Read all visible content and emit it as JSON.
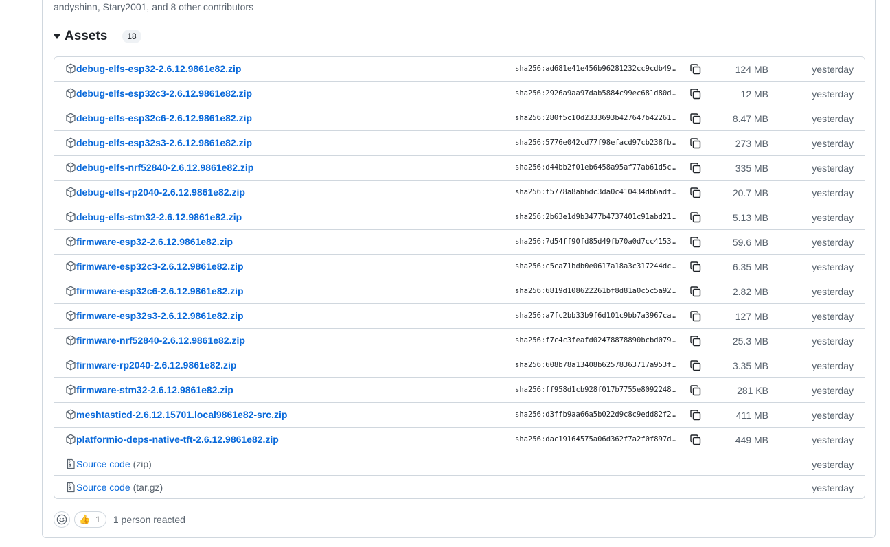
{
  "release": {
    "contributors_text": "andyshinn, Stary2001, and 8 other contributors"
  },
  "assets": {
    "title": "Assets",
    "count": "18",
    "items": [
      {
        "name": "debug-elfs-esp32-2.6.12.9861e82.zip",
        "sha": "sha256:ad681e41e456b96281232cc9cdb49…",
        "size": "124 MB",
        "date": "yesterday"
      },
      {
        "name": "debug-elfs-esp32c3-2.6.12.9861e82.zip",
        "sha": "sha256:2926a9aa97dab5884c99ec681d80d…",
        "size": "12 MB",
        "date": "yesterday"
      },
      {
        "name": "debug-elfs-esp32c6-2.6.12.9861e82.zip",
        "sha": "sha256:280f5c10d2333693b427647b42261…",
        "size": "8.47 MB",
        "date": "yesterday"
      },
      {
        "name": "debug-elfs-esp32s3-2.6.12.9861e82.zip",
        "sha": "sha256:5776e042cd77f98efacd97cb238fb…",
        "size": "273 MB",
        "date": "yesterday"
      },
      {
        "name": "debug-elfs-nrf52840-2.6.12.9861e82.zip",
        "sha": "sha256:d44bb2f01eb6458a95af77ab61d5c…",
        "size": "335 MB",
        "date": "yesterday"
      },
      {
        "name": "debug-elfs-rp2040-2.6.12.9861e82.zip",
        "sha": "sha256:f5778a8ab6dc3da0c410434db6adf…",
        "size": "20.7 MB",
        "date": "yesterday"
      },
      {
        "name": "debug-elfs-stm32-2.6.12.9861e82.zip",
        "sha": "sha256:2b63e1d9b3477b4737401c91abd21…",
        "size": "5.13 MB",
        "date": "yesterday"
      },
      {
        "name": "firmware-esp32-2.6.12.9861e82.zip",
        "sha": "sha256:7d54ff90fd85d49fb70a0d7cc4153…",
        "size": "59.6 MB",
        "date": "yesterday"
      },
      {
        "name": "firmware-esp32c3-2.6.12.9861e82.zip",
        "sha": "sha256:c5ca71bdb0e0617a18a3c317244dc…",
        "size": "6.35 MB",
        "date": "yesterday"
      },
      {
        "name": "firmware-esp32c6-2.6.12.9861e82.zip",
        "sha": "sha256:6819d108622261bf8d81a0c5c5a92…",
        "size": "2.82 MB",
        "date": "yesterday"
      },
      {
        "name": "firmware-esp32s3-2.6.12.9861e82.zip",
        "sha": "sha256:a7fc2bb33b9f6d101c9bb7a3967ca…",
        "size": "127 MB",
        "date": "yesterday"
      },
      {
        "name": "firmware-nrf52840-2.6.12.9861e82.zip",
        "sha": "sha256:f7c4c3feafd02478878890bcbd079…",
        "size": "25.3 MB",
        "date": "yesterday"
      },
      {
        "name": "firmware-rp2040-2.6.12.9861e82.zip",
        "sha": "sha256:608b78a13408b62578363717a953f…",
        "size": "3.35 MB",
        "date": "yesterday"
      },
      {
        "name": "firmware-stm32-2.6.12.9861e82.zip",
        "sha": "sha256:ff958d1cb928f017b7755e8092248…",
        "size": "281 KB",
        "date": "yesterday"
      },
      {
        "name": "meshtasticd-2.6.12.15701.local9861e82-src.zip",
        "sha": "sha256:d3ffb9aa66a5b022d9c8c9edd82f2…",
        "size": "411 MB",
        "date": "yesterday"
      },
      {
        "name": "platformio-deps-native-tft-2.6.12.9861e82.zip",
        "sha": "sha256:dac19164575a06d362f7a2f0f897d…",
        "size": "449 MB",
        "date": "yesterday"
      }
    ],
    "source_items": [
      {
        "label": "Source code",
        "format": "(zip)",
        "date": "yesterday"
      },
      {
        "label": "Source code",
        "format": "(tar.gz)",
        "date": "yesterday"
      }
    ]
  },
  "reactions": {
    "emoji": "👍",
    "count": "1",
    "summary": "1 person reacted"
  },
  "icons": {
    "package": "package-icon",
    "file_zip": "file-zip-icon",
    "copy": "copy-icon",
    "smiley": "smiley-icon"
  },
  "colors": {
    "link": "#0969da",
    "muted": "#59636e",
    "border": "#d0d7de"
  }
}
